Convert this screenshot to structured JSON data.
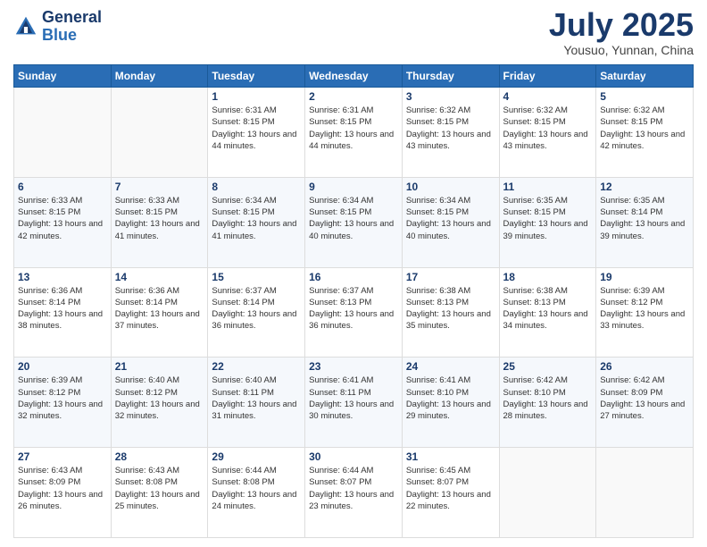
{
  "header": {
    "logo_line1": "General",
    "logo_line2": "Blue",
    "month": "July 2025",
    "location": "Yousuo, Yunnan, China"
  },
  "days_of_week": [
    "Sunday",
    "Monday",
    "Tuesday",
    "Wednesday",
    "Thursday",
    "Friday",
    "Saturday"
  ],
  "weeks": [
    [
      {
        "day": "",
        "info": ""
      },
      {
        "day": "",
        "info": ""
      },
      {
        "day": "1",
        "info": "Sunrise: 6:31 AM\nSunset: 8:15 PM\nDaylight: 13 hours and 44 minutes."
      },
      {
        "day": "2",
        "info": "Sunrise: 6:31 AM\nSunset: 8:15 PM\nDaylight: 13 hours and 44 minutes."
      },
      {
        "day": "3",
        "info": "Sunrise: 6:32 AM\nSunset: 8:15 PM\nDaylight: 13 hours and 43 minutes."
      },
      {
        "day": "4",
        "info": "Sunrise: 6:32 AM\nSunset: 8:15 PM\nDaylight: 13 hours and 43 minutes."
      },
      {
        "day": "5",
        "info": "Sunrise: 6:32 AM\nSunset: 8:15 PM\nDaylight: 13 hours and 42 minutes."
      }
    ],
    [
      {
        "day": "6",
        "info": "Sunrise: 6:33 AM\nSunset: 8:15 PM\nDaylight: 13 hours and 42 minutes."
      },
      {
        "day": "7",
        "info": "Sunrise: 6:33 AM\nSunset: 8:15 PM\nDaylight: 13 hours and 41 minutes."
      },
      {
        "day": "8",
        "info": "Sunrise: 6:34 AM\nSunset: 8:15 PM\nDaylight: 13 hours and 41 minutes."
      },
      {
        "day": "9",
        "info": "Sunrise: 6:34 AM\nSunset: 8:15 PM\nDaylight: 13 hours and 40 minutes."
      },
      {
        "day": "10",
        "info": "Sunrise: 6:34 AM\nSunset: 8:15 PM\nDaylight: 13 hours and 40 minutes."
      },
      {
        "day": "11",
        "info": "Sunrise: 6:35 AM\nSunset: 8:15 PM\nDaylight: 13 hours and 39 minutes."
      },
      {
        "day": "12",
        "info": "Sunrise: 6:35 AM\nSunset: 8:14 PM\nDaylight: 13 hours and 39 minutes."
      }
    ],
    [
      {
        "day": "13",
        "info": "Sunrise: 6:36 AM\nSunset: 8:14 PM\nDaylight: 13 hours and 38 minutes."
      },
      {
        "day": "14",
        "info": "Sunrise: 6:36 AM\nSunset: 8:14 PM\nDaylight: 13 hours and 37 minutes."
      },
      {
        "day": "15",
        "info": "Sunrise: 6:37 AM\nSunset: 8:14 PM\nDaylight: 13 hours and 36 minutes."
      },
      {
        "day": "16",
        "info": "Sunrise: 6:37 AM\nSunset: 8:13 PM\nDaylight: 13 hours and 36 minutes."
      },
      {
        "day": "17",
        "info": "Sunrise: 6:38 AM\nSunset: 8:13 PM\nDaylight: 13 hours and 35 minutes."
      },
      {
        "day": "18",
        "info": "Sunrise: 6:38 AM\nSunset: 8:13 PM\nDaylight: 13 hours and 34 minutes."
      },
      {
        "day": "19",
        "info": "Sunrise: 6:39 AM\nSunset: 8:12 PM\nDaylight: 13 hours and 33 minutes."
      }
    ],
    [
      {
        "day": "20",
        "info": "Sunrise: 6:39 AM\nSunset: 8:12 PM\nDaylight: 13 hours and 32 minutes."
      },
      {
        "day": "21",
        "info": "Sunrise: 6:40 AM\nSunset: 8:12 PM\nDaylight: 13 hours and 32 minutes."
      },
      {
        "day": "22",
        "info": "Sunrise: 6:40 AM\nSunset: 8:11 PM\nDaylight: 13 hours and 31 minutes."
      },
      {
        "day": "23",
        "info": "Sunrise: 6:41 AM\nSunset: 8:11 PM\nDaylight: 13 hours and 30 minutes."
      },
      {
        "day": "24",
        "info": "Sunrise: 6:41 AM\nSunset: 8:10 PM\nDaylight: 13 hours and 29 minutes."
      },
      {
        "day": "25",
        "info": "Sunrise: 6:42 AM\nSunset: 8:10 PM\nDaylight: 13 hours and 28 minutes."
      },
      {
        "day": "26",
        "info": "Sunrise: 6:42 AM\nSunset: 8:09 PM\nDaylight: 13 hours and 27 minutes."
      }
    ],
    [
      {
        "day": "27",
        "info": "Sunrise: 6:43 AM\nSunset: 8:09 PM\nDaylight: 13 hours and 26 minutes."
      },
      {
        "day": "28",
        "info": "Sunrise: 6:43 AM\nSunset: 8:08 PM\nDaylight: 13 hours and 25 minutes."
      },
      {
        "day": "29",
        "info": "Sunrise: 6:44 AM\nSunset: 8:08 PM\nDaylight: 13 hours and 24 minutes."
      },
      {
        "day": "30",
        "info": "Sunrise: 6:44 AM\nSunset: 8:07 PM\nDaylight: 13 hours and 23 minutes."
      },
      {
        "day": "31",
        "info": "Sunrise: 6:45 AM\nSunset: 8:07 PM\nDaylight: 13 hours and 22 minutes."
      },
      {
        "day": "",
        "info": ""
      },
      {
        "day": "",
        "info": ""
      }
    ]
  ]
}
